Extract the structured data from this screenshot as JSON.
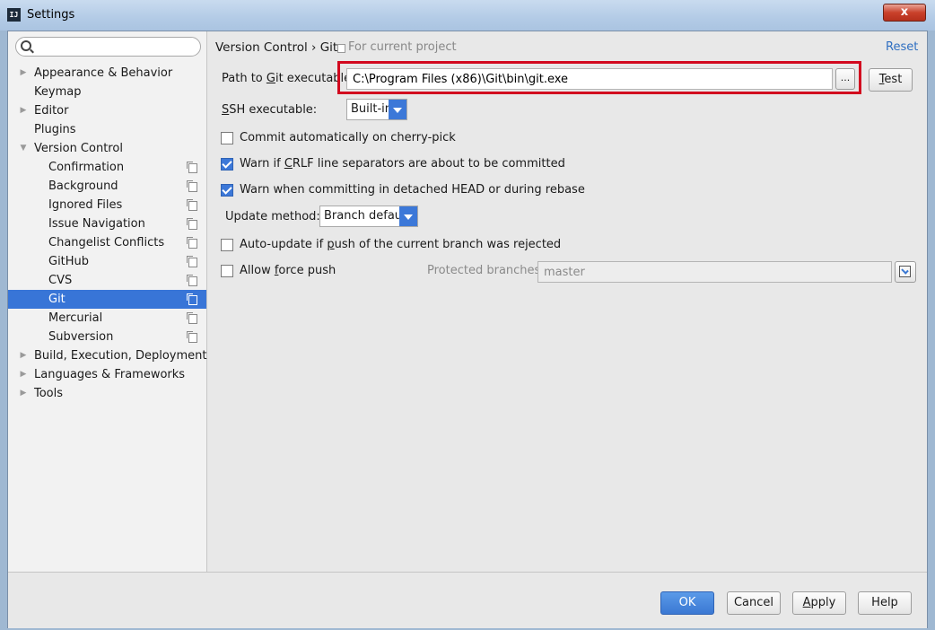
{
  "window": {
    "title": "Settings",
    "icon_text": "IJ",
    "close_label": "x"
  },
  "sidebar": {
    "search_placeholder": "",
    "items": [
      {
        "label": "Appearance & Behavior",
        "level": 0,
        "arrow": "right"
      },
      {
        "label": "Keymap",
        "level": 0,
        "arrow": "none"
      },
      {
        "label": "Editor",
        "level": 0,
        "arrow": "right"
      },
      {
        "label": "Plugins",
        "level": 0,
        "arrow": "none"
      },
      {
        "label": "Version Control",
        "level": 0,
        "arrow": "down"
      },
      {
        "label": "Confirmation",
        "level": 1,
        "project_icon": true
      },
      {
        "label": "Background",
        "level": 1,
        "project_icon": true
      },
      {
        "label": "Ignored Files",
        "level": 1,
        "project_icon": true
      },
      {
        "label": "Issue Navigation",
        "level": 1,
        "project_icon": true
      },
      {
        "label": "Changelist Conflicts",
        "level": 1,
        "project_icon": true
      },
      {
        "label": "GitHub",
        "level": 1,
        "project_icon": true
      },
      {
        "label": "CVS",
        "level": 1,
        "project_icon": true
      },
      {
        "label": "Git",
        "level": 1,
        "project_icon": true,
        "selected": true
      },
      {
        "label": "Mercurial",
        "level": 1,
        "project_icon": true
      },
      {
        "label": "Subversion",
        "level": 1,
        "project_icon": true
      },
      {
        "label": "Build, Execution, Deployment",
        "level": 0,
        "arrow": "right"
      },
      {
        "label": "Languages & Frameworks",
        "level": 0,
        "arrow": "right"
      },
      {
        "label": "Tools",
        "level": 0,
        "arrow": "right"
      }
    ]
  },
  "header": {
    "breadcrumb": "Version Control › Git",
    "scope": "For current project",
    "reset": "Reset"
  },
  "git": {
    "path_label_pre": "Path to ",
    "path_label_mnemonic": "G",
    "path_label_post": "it executable:",
    "path_value": "C:\\Program Files (x86)\\Git\\bin\\git.exe",
    "browse_label": "...",
    "test_mnemonic": "T",
    "test_rest": "est",
    "ssh_label_mnemonic": "S",
    "ssh_label_rest": "SH executable:",
    "ssh_value": "Built-in",
    "cherry_pick": {
      "label": "Commit automatically on cherry-pick",
      "checked": false
    },
    "crlf": {
      "label_pre": "Warn if ",
      "label_mnemonic": "C",
      "label_post": "RLF line separators are about to be committed",
      "checked": true
    },
    "detached": {
      "label": "Warn when committing in detached HEAD or during rebase",
      "checked": true
    },
    "update_method_label": "Update method:",
    "update_method_value": "Branch default",
    "auto_update": {
      "label_pre": "Auto-update if ",
      "label_mnemonic": "p",
      "label_post": "ush of the current branch was rejected",
      "checked": false
    },
    "force_push": {
      "label_pre": "Allow ",
      "label_mnemonic": "f",
      "label_post": "orce push",
      "checked": false
    },
    "protected_label": "Protected branches:",
    "protected_value": "master"
  },
  "footer": {
    "ok": "OK",
    "cancel": "Cancel",
    "apply_mnemonic": "A",
    "apply_rest": "pply",
    "help": "Help"
  },
  "colors": {
    "accent": "#3875d7",
    "highlight_border": "#d2091f",
    "link": "#2f6fc1"
  }
}
